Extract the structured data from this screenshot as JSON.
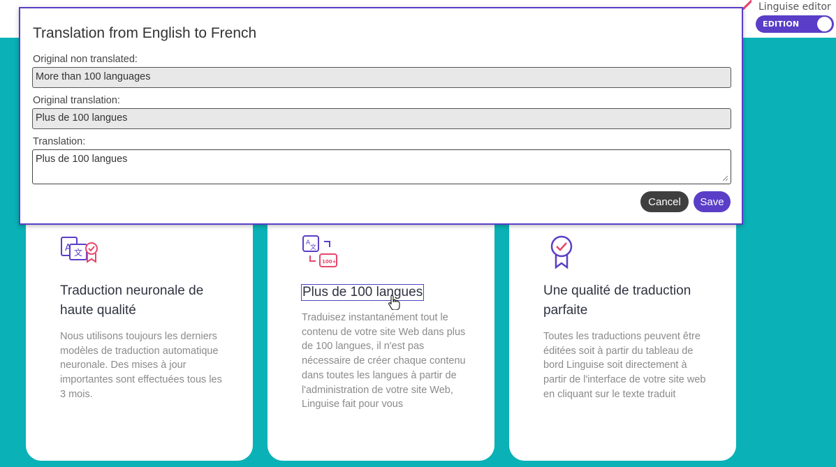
{
  "editor": {
    "title": "Linguise editor",
    "mode_label": "EDITION",
    "mode_on": true
  },
  "modal": {
    "title": "Translation from English to French",
    "original_label": "Original non translated:",
    "original_value": "More than 100 languages",
    "orig_translation_label": "Original translation:",
    "orig_translation_value": "Plus de 100 langues",
    "translation_label": "Translation:",
    "translation_value": "Plus de 100 langues",
    "cancel_label": "Cancel",
    "save_label": "Save"
  },
  "cards": [
    {
      "icon": "translate-quality-icon",
      "title": "Traduction neuronale de haute qualité",
      "description": "Nous utilisons toujours les derniers modèles de traduction automatique neuronale. Des mises à jour importantes sont effectuées tous les 3 mois."
    },
    {
      "icon": "languages-100-icon",
      "title": "Plus de 100 langues",
      "description": "Traduisez instantanément tout le contenu de votre site Web dans plus de 100 langues, il n'est pas nécessaire de créer chaque contenu dans toutes les langues à partir de l'administration de votre site Web, Linguise fait pour vous"
    },
    {
      "icon": "award-ribbon-icon",
      "title": "Une qualité de traduction parfaite",
      "description": "Toutes les traductions peuvent être éditées soit à partir du tableau de bord Linguise soit directement à partir de l'interface de votre site web en cliquant sur le texte traduit"
    }
  ],
  "colors": {
    "background": "#0ab1b7",
    "accent": "#5a3ec8",
    "icon_purple": "#5a3ec8",
    "icon_red": "#e8456b"
  }
}
